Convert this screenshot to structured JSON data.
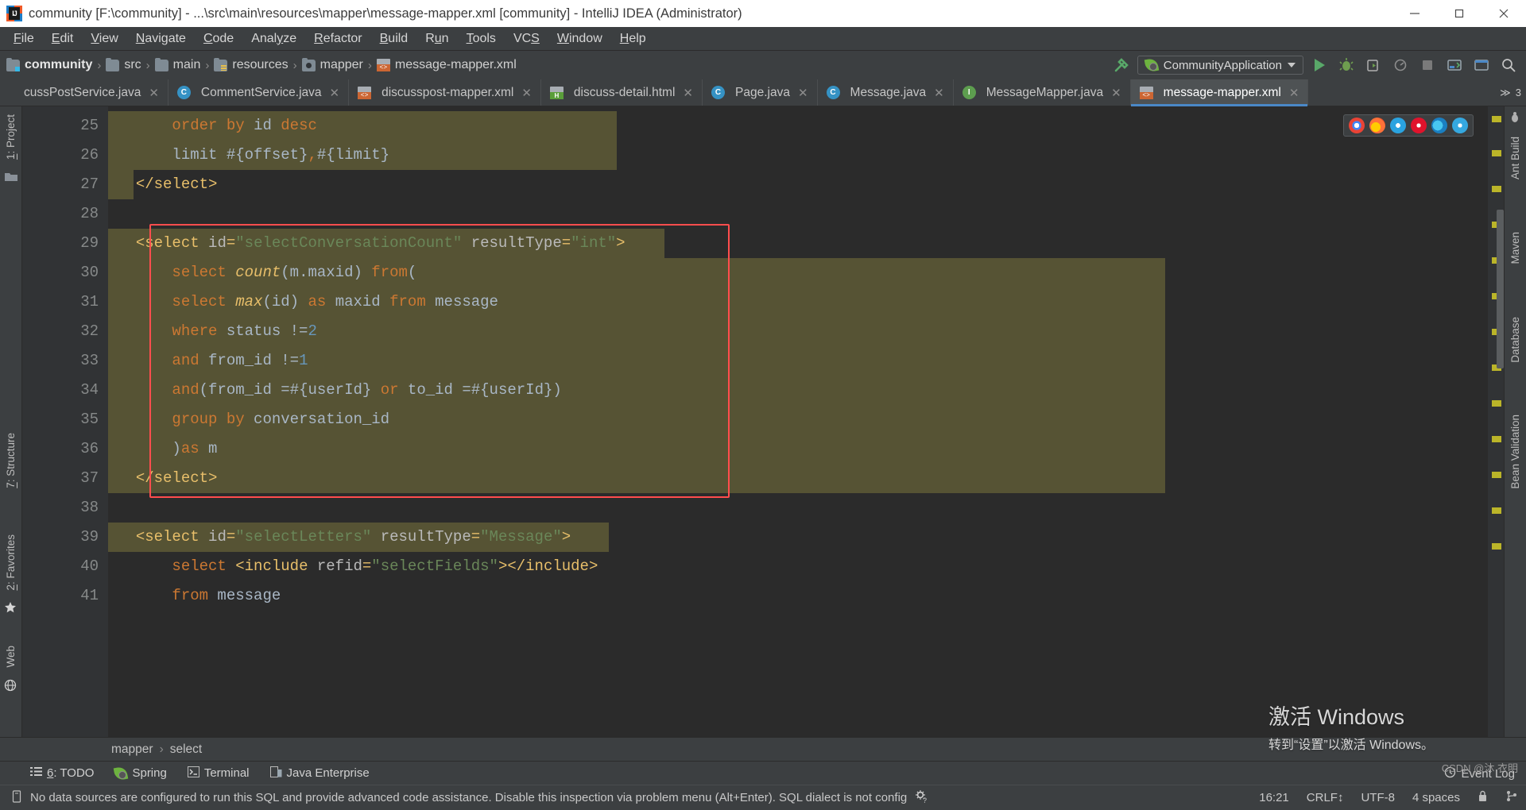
{
  "window": {
    "title": "community [F:\\community] - ...\\src\\main\\resources\\mapper\\message-mapper.xml [community] - IntelliJ IDEA (Administrator)",
    "app_icon": "intellij-idea-icon",
    "minimize": "—",
    "maximize": "❐",
    "close": "✕"
  },
  "menubar": {
    "items": [
      {
        "label": "File"
      },
      {
        "label": "Edit"
      },
      {
        "label": "View"
      },
      {
        "label": "Navigate"
      },
      {
        "label": "Code"
      },
      {
        "label": "Analyze"
      },
      {
        "label": "Refactor"
      },
      {
        "label": "Build"
      },
      {
        "label": "Run"
      },
      {
        "label": "Tools"
      },
      {
        "label": "VCS"
      },
      {
        "label": "Window"
      },
      {
        "label": "Help"
      }
    ]
  },
  "navbar": {
    "crumbs": [
      {
        "label": "community",
        "icon": "folder-module-icon"
      },
      {
        "label": "src",
        "icon": "folder-icon"
      },
      {
        "label": "main",
        "icon": "folder-icon"
      },
      {
        "label": "resources",
        "icon": "folder-resources-icon"
      },
      {
        "label": "mapper",
        "icon": "folder-package-icon"
      },
      {
        "label": "message-mapper.xml",
        "icon": "xml-file-icon"
      }
    ],
    "separator": "›",
    "build_hammer": "build-hammer-icon",
    "run_config": "CommunityApplication",
    "run_config_icon": "spring-boot-icon",
    "buttons": [
      {
        "name": "run-button",
        "icon": "run-triangle-icon"
      },
      {
        "name": "debug-button",
        "icon": "debug-bug-icon"
      },
      {
        "name": "run-with-coverage-button",
        "icon": "coverage-icon"
      },
      {
        "name": "profile-button",
        "icon": "profiler-icon"
      },
      {
        "name": "stop-button",
        "icon": "stop-square-icon"
      },
      {
        "name": "update-app-button",
        "icon": "update-app-icon"
      },
      {
        "name": "open-window-button",
        "icon": "window-icon"
      },
      {
        "name": "search-everywhere-button",
        "icon": "search-icon"
      }
    ]
  },
  "tabs": [
    {
      "label": "cussPostService.java",
      "icon": "java-class-icon",
      "clipped": true,
      "active": false
    },
    {
      "label": "CommentService.java",
      "icon": "java-class-icon",
      "clipped": false,
      "active": false
    },
    {
      "label": "discusspost-mapper.xml",
      "icon": "xml-file-icon",
      "clipped": false,
      "active": false
    },
    {
      "label": "discuss-detail.html",
      "icon": "html-file-icon",
      "clipped": false,
      "active": false
    },
    {
      "label": "Page.java",
      "icon": "java-class-icon",
      "clipped": false,
      "active": false
    },
    {
      "label": "Message.java",
      "icon": "java-class-icon",
      "clipped": false,
      "active": false
    },
    {
      "label": "MessageMapper.java",
      "icon": "java-interface-icon",
      "clipped": false,
      "active": false
    },
    {
      "label": "message-mapper.xml",
      "icon": "xml-file-icon",
      "clipped": false,
      "active": true
    }
  ],
  "tabs_overflow": "3",
  "left_toolwindows": [
    {
      "label": "1: Project"
    },
    {
      "label": "7: Structure"
    },
    {
      "label": "2: Favorites"
    },
    {
      "label": "Web"
    }
  ],
  "right_toolwindows": [
    {
      "label": "Ant Build"
    },
    {
      "label": "Maven"
    },
    {
      "label": "Database"
    },
    {
      "label": "Bean Validation"
    }
  ],
  "editor": {
    "first_line": 25,
    "lines": [
      {
        "n": 25,
        "highlight": true,
        "hl_w": 640,
        "fold": null,
        "tokens": [
          {
            "t": "      ",
            "c": "tok-plain"
          },
          {
            "t": "order",
            "c": "tok-kw"
          },
          {
            "t": " ",
            "c": "tok-plain"
          },
          {
            "t": "by",
            "c": "tok-kw"
          },
          {
            "t": " ",
            "c": "tok-plain"
          },
          {
            "t": "id",
            "c": "tok-ident"
          },
          {
            "t": " ",
            "c": "tok-plain"
          },
          {
            "t": "desc",
            "c": "tok-kw"
          }
        ]
      },
      {
        "n": 26,
        "highlight": true,
        "hl_w": 640,
        "fold": null,
        "tokens": [
          {
            "t": "      ",
            "c": "tok-plain"
          },
          {
            "t": "limit",
            "c": "tok-ident"
          },
          {
            "t": " ",
            "c": "tok-plain"
          },
          {
            "t": "#{offset}",
            "c": "tok-plain"
          },
          {
            "t": ",",
            "c": "tok-kw"
          },
          {
            "t": "#{limit}",
            "c": "tok-plain"
          }
        ]
      },
      {
        "n": 27,
        "highlight": true,
        "hl_w": 32,
        "fold": "minus",
        "tokens": [
          {
            "t": "  ",
            "c": "tok-plain"
          },
          {
            "t": "</select>",
            "c": "tok-tag"
          }
        ]
      },
      {
        "n": 28,
        "highlight": false,
        "hl_w": 0,
        "fold": null,
        "tokens": []
      },
      {
        "n": 29,
        "highlight": true,
        "hl_w": 700,
        "fold": "collapse",
        "tokens": [
          {
            "t": "  ",
            "c": "tok-plain"
          },
          {
            "t": "<select",
            "c": "tok-tag"
          },
          {
            "t": " ",
            "c": "tok-plain"
          },
          {
            "t": "id",
            "c": "tok-attr"
          },
          {
            "t": "=",
            "c": "tok-tag"
          },
          {
            "t": "\"selectConversationCount\"",
            "c": "tok-str"
          },
          {
            "t": " ",
            "c": "tok-plain"
          },
          {
            "t": "resultType",
            "c": "tok-attr"
          },
          {
            "t": "=",
            "c": "tok-tag"
          },
          {
            "t": "\"int\"",
            "c": "tok-str"
          },
          {
            "t": ">",
            "c": "tok-tag"
          }
        ]
      },
      {
        "n": 30,
        "highlight": true,
        "hl_w": 1330,
        "fold": "collapse",
        "tokens": [
          {
            "t": "      ",
            "c": "tok-plain"
          },
          {
            "t": "select",
            "c": "tok-kw"
          },
          {
            "t": " ",
            "c": "tok-plain"
          },
          {
            "t": "count",
            "c": "tok-fn"
          },
          {
            "t": "(m.maxid) ",
            "c": "tok-ident"
          },
          {
            "t": "from",
            "c": "tok-kw"
          },
          {
            "t": "(",
            "c": "tok-ident"
          }
        ]
      },
      {
        "n": 31,
        "highlight": true,
        "hl_w": 1330,
        "fold": "collapse",
        "tokens": [
          {
            "t": "      ",
            "c": "tok-plain"
          },
          {
            "t": "select",
            "c": "tok-kw"
          },
          {
            "t": " ",
            "c": "tok-plain"
          },
          {
            "t": "max",
            "c": "tok-fn"
          },
          {
            "t": "(id) ",
            "c": "tok-ident"
          },
          {
            "t": "as",
            "c": "tok-kw"
          },
          {
            "t": " maxid ",
            "c": "tok-ident"
          },
          {
            "t": "from",
            "c": "tok-kw"
          },
          {
            "t": " message",
            "c": "tok-ident"
          }
        ]
      },
      {
        "n": 32,
        "highlight": true,
        "hl_w": 1330,
        "fold": null,
        "tokens": [
          {
            "t": "      ",
            "c": "tok-plain"
          },
          {
            "t": "where",
            "c": "tok-kw"
          },
          {
            "t": " status ",
            "c": "tok-ident"
          },
          {
            "t": "!=",
            "c": "tok-ident"
          },
          {
            "t": "2",
            "c": "tok-num"
          }
        ]
      },
      {
        "n": 33,
        "highlight": true,
        "hl_w": 1330,
        "fold": null,
        "tokens": [
          {
            "t": "      ",
            "c": "tok-plain"
          },
          {
            "t": "and",
            "c": "tok-kw"
          },
          {
            "t": " from_id ",
            "c": "tok-ident"
          },
          {
            "t": "!=",
            "c": "tok-ident"
          },
          {
            "t": "1",
            "c": "tok-num"
          }
        ]
      },
      {
        "n": 34,
        "highlight": true,
        "hl_w": 1330,
        "fold": null,
        "tokens": [
          {
            "t": "      ",
            "c": "tok-plain"
          },
          {
            "t": "and",
            "c": "tok-kw"
          },
          {
            "t": "(from_id ",
            "c": "tok-ident"
          },
          {
            "t": "=",
            "c": "tok-ident"
          },
          {
            "t": "#{userId} ",
            "c": "tok-plain"
          },
          {
            "t": "or",
            "c": "tok-kw"
          },
          {
            "t": " to_id ",
            "c": "tok-ident"
          },
          {
            "t": "=",
            "c": "tok-ident"
          },
          {
            "t": "#{userId})",
            "c": "tok-plain"
          }
        ]
      },
      {
        "n": 35,
        "highlight": true,
        "hl_w": 1330,
        "fold": "collapse",
        "tokens": [
          {
            "t": "      ",
            "c": "tok-plain"
          },
          {
            "t": "group",
            "c": "tok-kw"
          },
          {
            "t": " ",
            "c": "tok-plain"
          },
          {
            "t": "by",
            "c": "tok-kw"
          },
          {
            "t": " conversation_id",
            "c": "tok-ident"
          }
        ]
      },
      {
        "n": 36,
        "highlight": true,
        "hl_w": 1330,
        "fold": "collapse",
        "tokens": [
          {
            "t": "      ",
            "c": "tok-plain"
          },
          {
            "t": ")",
            "c": "tok-ident"
          },
          {
            "t": "as",
            "c": "tok-kw"
          },
          {
            "t": " m",
            "c": "tok-ident"
          }
        ]
      },
      {
        "n": 37,
        "highlight": true,
        "hl_w": 1330,
        "fold": "collapse",
        "tokens": [
          {
            "t": "  ",
            "c": "tok-plain"
          },
          {
            "t": "</select>",
            "c": "tok-tag"
          }
        ]
      },
      {
        "n": 38,
        "highlight": false,
        "hl_w": 0,
        "fold": null,
        "tokens": []
      },
      {
        "n": 39,
        "highlight": true,
        "hl_w": 630,
        "fold": "collapse",
        "tokens": [
          {
            "t": "  ",
            "c": "tok-plain"
          },
          {
            "t": "<select",
            "c": "tok-tag"
          },
          {
            "t": " ",
            "c": "tok-plain"
          },
          {
            "t": "id",
            "c": "tok-attr"
          },
          {
            "t": "=",
            "c": "tok-tag"
          },
          {
            "t": "\"selectLetters\"",
            "c": "tok-str"
          },
          {
            "t": " ",
            "c": "tok-plain"
          },
          {
            "t": "resultType",
            "c": "tok-attr"
          },
          {
            "t": "=",
            "c": "tok-tag"
          },
          {
            "t": "\"Message\"",
            "c": "tok-str"
          },
          {
            "t": ">",
            "c": "tok-tag"
          }
        ]
      },
      {
        "n": 40,
        "highlight": false,
        "hl_w": 0,
        "fold": "collapse",
        "tokens": [
          {
            "t": "      ",
            "c": "tok-plain"
          },
          {
            "t": "select",
            "c": "tok-kw"
          },
          {
            "t": " ",
            "c": "tok-plain"
          },
          {
            "t": "<include",
            "c": "tok-tag"
          },
          {
            "t": " ",
            "c": "tok-plain"
          },
          {
            "t": "refid",
            "c": "tok-attr"
          },
          {
            "t": "=",
            "c": "tok-tag"
          },
          {
            "t": "\"selectFields\"",
            "c": "tok-str"
          },
          {
            "t": "></include>",
            "c": "tok-tag"
          }
        ]
      },
      {
        "n": 41,
        "highlight": false,
        "hl_w": 0,
        "fold": null,
        "tokens": [
          {
            "t": "      ",
            "c": "tok-plain"
          },
          {
            "t": "from",
            "c": "tok-kw"
          },
          {
            "t": " message",
            "c": "tok-ident"
          }
        ]
      }
    ],
    "selection_box": {
      "label": "selected-code-region"
    },
    "browser_icons": [
      "chrome-icon",
      "firefox-icon",
      "safari-icon",
      "opera-icon",
      "edge-icon",
      "ie-icon"
    ]
  },
  "breadcrumb_bottom": {
    "items": [
      "mapper",
      "select"
    ],
    "separator": "›"
  },
  "toolwindow_bar": [
    {
      "label": "6: TODO",
      "mnemonic": "6",
      "icon": "todo-icon"
    },
    {
      "label": "Spring",
      "icon": "spring-icon"
    },
    {
      "label": "Terminal",
      "icon": "terminal-icon"
    },
    {
      "label": "Java Enterprise",
      "icon": "java-enterprise-icon"
    }
  ],
  "statusbar": {
    "message": "No data sources are configured to run this SQL and provide advanced code assistance. Disable this inspection via problem menu (Alt+Enter). SQL dialect is not config",
    "message_icon": "inspection-icon",
    "trailing_icon": "configure-icon",
    "time": "16:21",
    "line_separator": "CRLF",
    "line_separator_caret": "↕",
    "encoding": "UTF-8",
    "indent": "4 spaces",
    "lock_icon": "lock-icon",
    "git_branch_icon": "git-icon"
  },
  "event_log": {
    "label": "Event Log",
    "icon": "event-log-icon"
  },
  "watermark": {
    "line1": "激活 Windows",
    "line2": "转到“设置”以激活 Windows。"
  },
  "csdn": "CSDN @沐 衣明",
  "colors": {
    "editor_bg": "#2b2b2b",
    "gutter_bg": "#313335",
    "chrome_bg": "#3c3f41",
    "highlight_band": "#565334",
    "selection_border": "#ff4d4d",
    "tab_active": "#4e5254",
    "accent_blue": "#4a88c7",
    "keyword": "#cc7832",
    "string": "#6a8759",
    "number": "#6897bb",
    "tag": "#e8bf6a"
  }
}
